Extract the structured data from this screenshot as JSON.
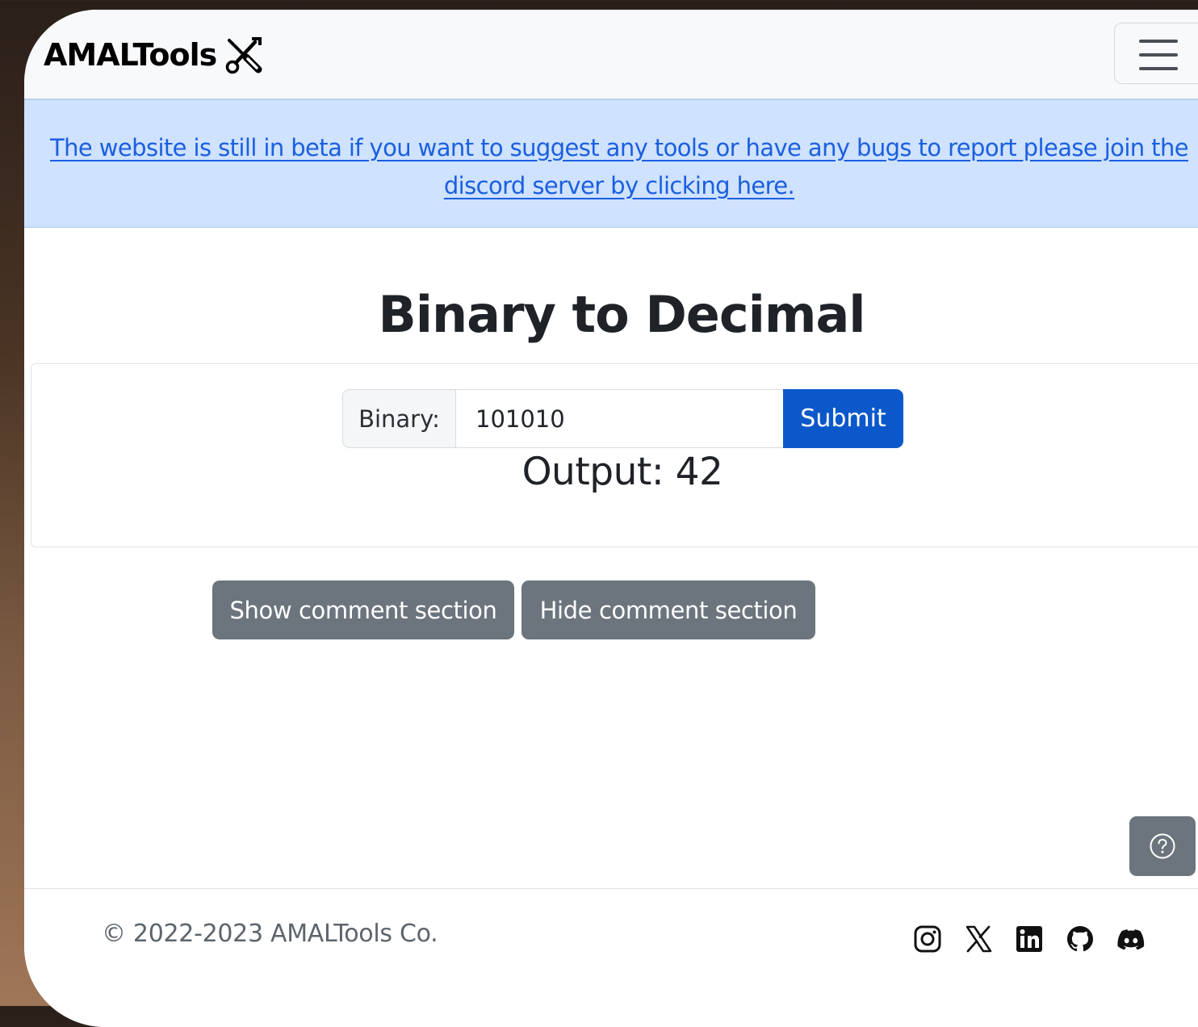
{
  "navbar": {
    "brand": "AMALTools",
    "brand_icon": "tools-icon",
    "menu_icon": "hamburger-icon"
  },
  "banner": {
    "text": "The website is still in beta if you want to suggest any tools or have any bugs to report please join the discord server by clicking here."
  },
  "main": {
    "title": "Binary to Decimal",
    "input_label": "Binary:",
    "input_value": "101010",
    "submit_label": "Submit",
    "output_label": "Output:",
    "output_value": "42",
    "show_comments_label": "Show comment section",
    "hide_comments_label": "Hide comment section",
    "help_icon": "question-circle-icon"
  },
  "footer": {
    "copyright": "© 2022-2023 AMALTools Co.",
    "social": [
      "instagram-icon",
      "x-icon",
      "linkedin-icon",
      "github-icon",
      "discord-icon"
    ]
  },
  "colors": {
    "primary": "#0b58ca",
    "secondary": "#6c757d",
    "banner_bg": "#cfe2ff",
    "link": "#1a5fe0"
  }
}
